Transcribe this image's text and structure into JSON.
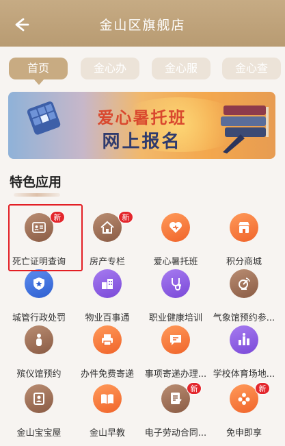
{
  "header": {
    "title": "金山区旗舰店",
    "back_icon": "back-arrow-icon"
  },
  "tabs": [
    {
      "label": "首页",
      "active": true
    },
    {
      "label": "金心办",
      "active": false
    },
    {
      "label": "金心服",
      "active": false
    },
    {
      "label": "金心查",
      "active": false
    }
  ],
  "banner": {
    "line1": "爱心暑托班",
    "line2": "网上报名"
  },
  "section": {
    "title": "特色应用"
  },
  "badge_text": "新",
  "apps": [
    {
      "label": "死亡证明查询",
      "icon": "certificate-icon",
      "color": "brown",
      "badge": true,
      "highlighted": true
    },
    {
      "label": "房产专栏",
      "icon": "house-icon",
      "color": "brown",
      "badge": true
    },
    {
      "label": "爱心暑托班",
      "icon": "heart-icon",
      "color": "orange",
      "badge": false
    },
    {
      "label": "积分商城",
      "icon": "shop-icon",
      "color": "orange",
      "badge": false
    },
    {
      "label": "城管行政处罚",
      "icon": "shield-star-icon",
      "color": "blue",
      "badge": false
    },
    {
      "label": "物业百事通",
      "icon": "buildings-icon",
      "color": "purple",
      "badge": false
    },
    {
      "label": "职业健康培训",
      "icon": "stethoscope-icon",
      "color": "purple",
      "badge": false
    },
    {
      "label": "气象馆预约参...",
      "icon": "satellite-icon",
      "color": "brown",
      "badge": false
    },
    {
      "label": "殡仪馆预约",
      "icon": "person-icon",
      "color": "brown",
      "badge": false
    },
    {
      "label": "办件免费寄递",
      "icon": "printer-icon",
      "color": "orange",
      "badge": false
    },
    {
      "label": "事项寄递办理...",
      "icon": "message-icon",
      "color": "orange",
      "badge": false
    },
    {
      "label": "学校体育场地...",
      "icon": "stadium-icon",
      "color": "purple",
      "badge": false
    },
    {
      "label": "金山宝宝屋",
      "icon": "baby-house-icon",
      "color": "brown",
      "badge": false
    },
    {
      "label": "金山早教",
      "icon": "book-icon",
      "color": "orange",
      "badge": false
    },
    {
      "label": "电子劳动合同...",
      "icon": "contract-icon",
      "color": "brown",
      "badge": true
    },
    {
      "label": "免申即享",
      "icon": "flower-icon",
      "color": "orange",
      "badge": true
    }
  ]
}
